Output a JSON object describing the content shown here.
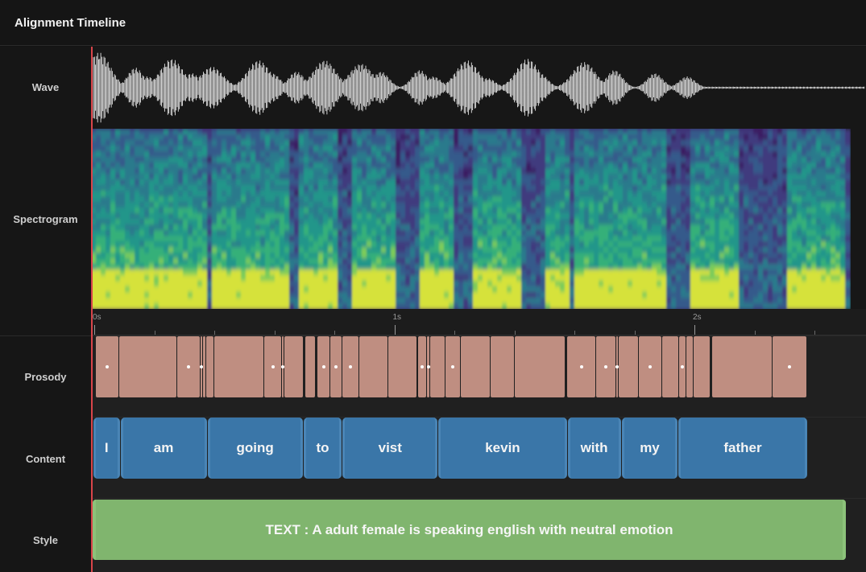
{
  "header": {
    "title": "Alignment Timeline"
  },
  "tracks": {
    "wave": "Wave",
    "spectrogram": "Spectrogram",
    "prosody": "Prosody",
    "content": "Content",
    "style": "Style"
  },
  "ruler": {
    "labels": [
      {
        "time": 0,
        "text": "0s"
      },
      {
        "time": 1,
        "text": "1s"
      },
      {
        "time": 2,
        "text": "2s"
      }
    ]
  },
  "words": [
    {
      "text": "I",
      "start": 0.0,
      "end": 0.09
    },
    {
      "text": "am",
      "start": 0.09,
      "end": 0.38
    },
    {
      "text": "going",
      "start": 0.38,
      "end": 0.7
    },
    {
      "text": "to",
      "start": 0.7,
      "end": 0.83
    },
    {
      "text": "vist",
      "start": 0.83,
      "end": 1.15
    },
    {
      "text": "kevin",
      "start": 1.15,
      "end": 1.58
    },
    {
      "text": "with",
      "start": 1.58,
      "end": 1.76
    },
    {
      "text": "my",
      "start": 1.76,
      "end": 1.95
    },
    {
      "text": "father",
      "start": 1.95,
      "end": 2.38
    }
  ],
  "style": {
    "text": "TEXT : A adult female is speaking english with neutral emotion"
  },
  "colors": {
    "prosody": "#bf8e81",
    "content": "#3a76a8",
    "style": "#80b56e",
    "playhead": "#d9454a"
  }
}
